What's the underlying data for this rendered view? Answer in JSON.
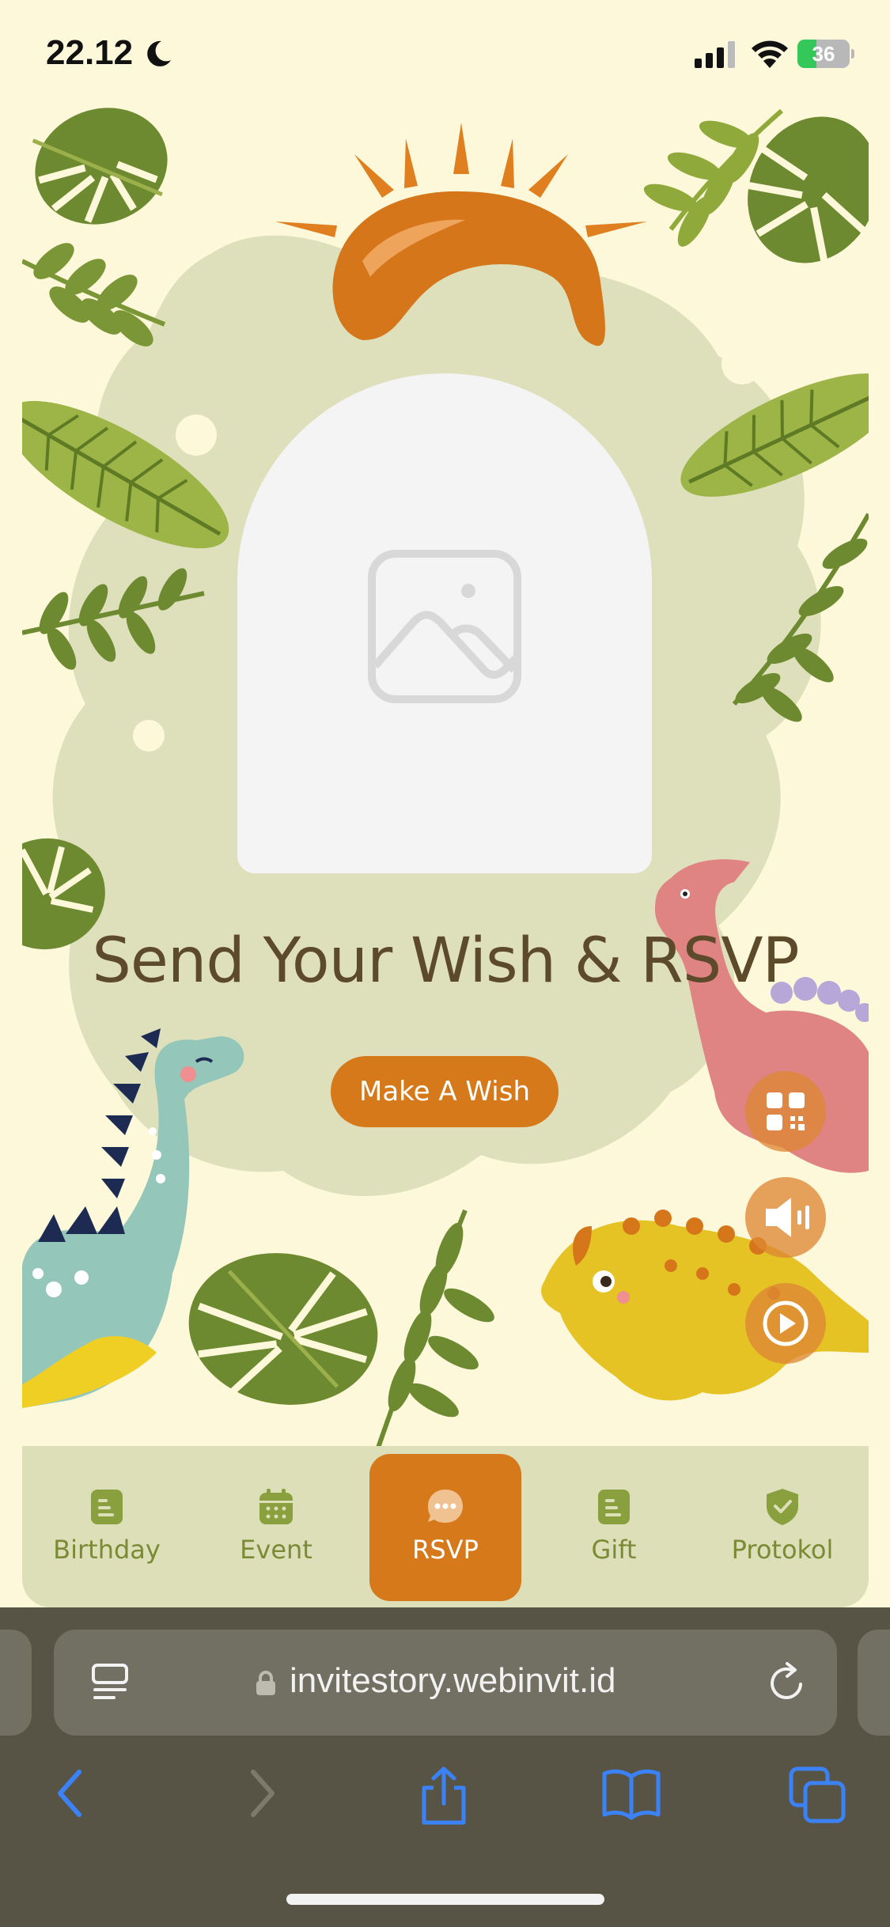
{
  "status": {
    "time": "22.12",
    "battery": "36",
    "battery_level": 0.36
  },
  "hero": {
    "title": "Send Your Wish & RSVP",
    "wish_button": "Make A Wish"
  },
  "floating": {
    "qr": "qr-code-icon",
    "sound": "speaker-icon",
    "play": "play-icon"
  },
  "nav": {
    "items": [
      {
        "label": "Birthday",
        "icon": "document-icon"
      },
      {
        "label": "Event",
        "icon": "calendar-icon"
      },
      {
        "label": "RSVP",
        "icon": "chat-bubble-icon",
        "active": true
      },
      {
        "label": "Gift",
        "icon": "document-icon"
      },
      {
        "label": "Protokol",
        "icon": "shield-check-icon"
      }
    ]
  },
  "browser": {
    "url": "invitestory.webinvit.id"
  },
  "colors": {
    "background": "#fdf8da",
    "accent": "#d5791b",
    "nav_bg": "#dcdfb8",
    "nav_text": "#7b8b35",
    "title": "#5c4a2a",
    "toolbar": "#575446",
    "toolbar_icon": "#3b82f6"
  }
}
